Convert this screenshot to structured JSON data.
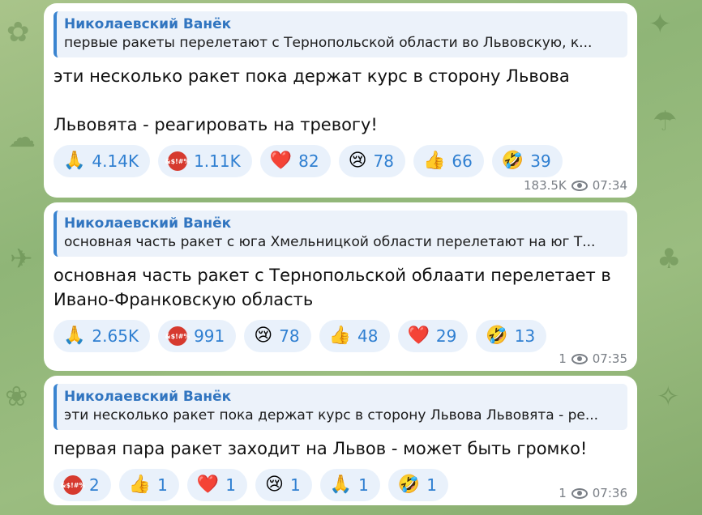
{
  "messages": [
    {
      "reply_name": "Николаевский Ванёк",
      "reply_text": "первые ракеты перелетают с Тернопольской области во Львовскую, к...",
      "body_lines": [
        "эти несколько ракет пока держат курс в сторону Львова",
        "",
        "Львовята - реагировать на тревогу!"
      ],
      "reactions": [
        {
          "emoji": "🙏",
          "count": "4.14K"
        },
        {
          "emoji": "angry",
          "count": "1.11K"
        },
        {
          "emoji": "❤️",
          "count": "82"
        },
        {
          "emoji": "😢",
          "count": "78"
        },
        {
          "emoji": "👍",
          "count": "66"
        },
        {
          "emoji": "🤣",
          "count": "39"
        }
      ],
      "views": "183.5K",
      "time": "07:34"
    },
    {
      "reply_name": "Николаевский Ванёк",
      "reply_text": "основная часть ракет с юга Хмельницкой области перелетают на юг Т...",
      "body_lines": [
        "основная часть ракет с Тернопольской облаати перелетает в",
        "Ивано-Франковскую область"
      ],
      "reactions": [
        {
          "emoji": "🙏",
          "count": "2.65K"
        },
        {
          "emoji": "angry",
          "count": "991"
        },
        {
          "emoji": "😢",
          "count": "78"
        },
        {
          "emoji": "👍",
          "count": "48"
        },
        {
          "emoji": "❤️",
          "count": "29"
        },
        {
          "emoji": "🤣",
          "count": "13"
        }
      ],
      "views": "1",
      "time": "07:35"
    },
    {
      "reply_name": "Николаевский Ванёк",
      "reply_text": "эти несколько ракет пока держат курс в сторону Львова Львовята - ре...",
      "body_lines": [
        "первая пара ракет заходит на Львов - может быть громко!"
      ],
      "reactions": [
        {
          "emoji": "angry",
          "count": "2"
        },
        {
          "emoji": "👍",
          "count": "1"
        },
        {
          "emoji": "❤️",
          "count": "1"
        },
        {
          "emoji": "😢",
          "count": "1"
        },
        {
          "emoji": "🙏",
          "count": "1"
        },
        {
          "emoji": "🤣",
          "count": "1"
        }
      ],
      "views": "1",
      "time": "07:36"
    }
  ],
  "angry_label": "&$!#%"
}
